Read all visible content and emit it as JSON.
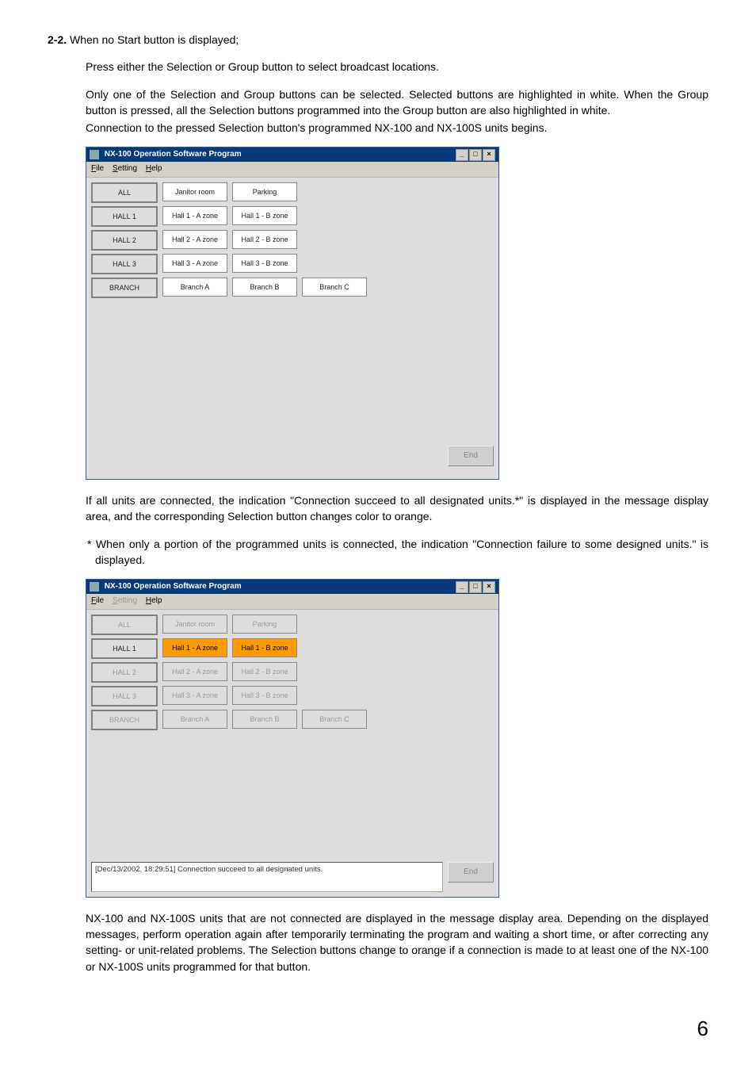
{
  "section": {
    "num": "2-2.",
    "heading": "When no Start button is displayed;"
  },
  "p1": "Press either the Selection or Group button to select broadcast locations.",
  "p2": "Only one of the Selection and Group buttons can be selected. Selected buttons are highlighted in white. When the Group button is pressed, all the Selection buttons programmed into the Group button are also highlighted in white.",
  "p3": "Connection to the pressed Selection button's programmed NX-100 and NX-100S units begins.",
  "win": {
    "title": "NX-100 Operation Software Program",
    "menu": {
      "file": "File",
      "setting": "Setting",
      "help": "Help"
    },
    "group": {
      "all": "ALL",
      "hall1": "HALL 1",
      "hall2": "HALL 2",
      "hall3": "HALL 3",
      "branch": "BRANCH"
    },
    "sel": {
      "janitor": "Janitor room",
      "parking": "Parking",
      "h1a": "Hall 1 - A zone",
      "h1b": "Hall 1 - B zone",
      "h2a": "Hall 2 - A zone",
      "h2b": "Hall 2 - B zone",
      "h3a": "Hall 3 - A zone",
      "h3b": "Hall 3 - B zone",
      "ba": "Branch A",
      "bb": "Branch B",
      "bc": "Branch C"
    },
    "end": "End"
  },
  "p4": "If all units are connected, the indication \"Connection succeed to all designated units.*\" is displayed in the message display area, and the corresponding Selection button changes color to orange.",
  "p5": "* When only a portion of the programmed units is connected, the indication \"Connection failure to some designed units.\" is displayed.",
  "msg": "[Dec/13/2002, 18:29:51] Connection succeed to all designated units.",
  "p6": "NX-100 and NX-100S units that are not connected are displayed in the message display area. Depending on the displayed messages, perform operation again after temporarily terminating the program and waiting a short time, or after correcting any setting- or unit-related problems. The Selection buttons change to orange if a connection is made to at least one of the NX-100 or NX-100S units programmed for that button.",
  "pagenum": "6"
}
